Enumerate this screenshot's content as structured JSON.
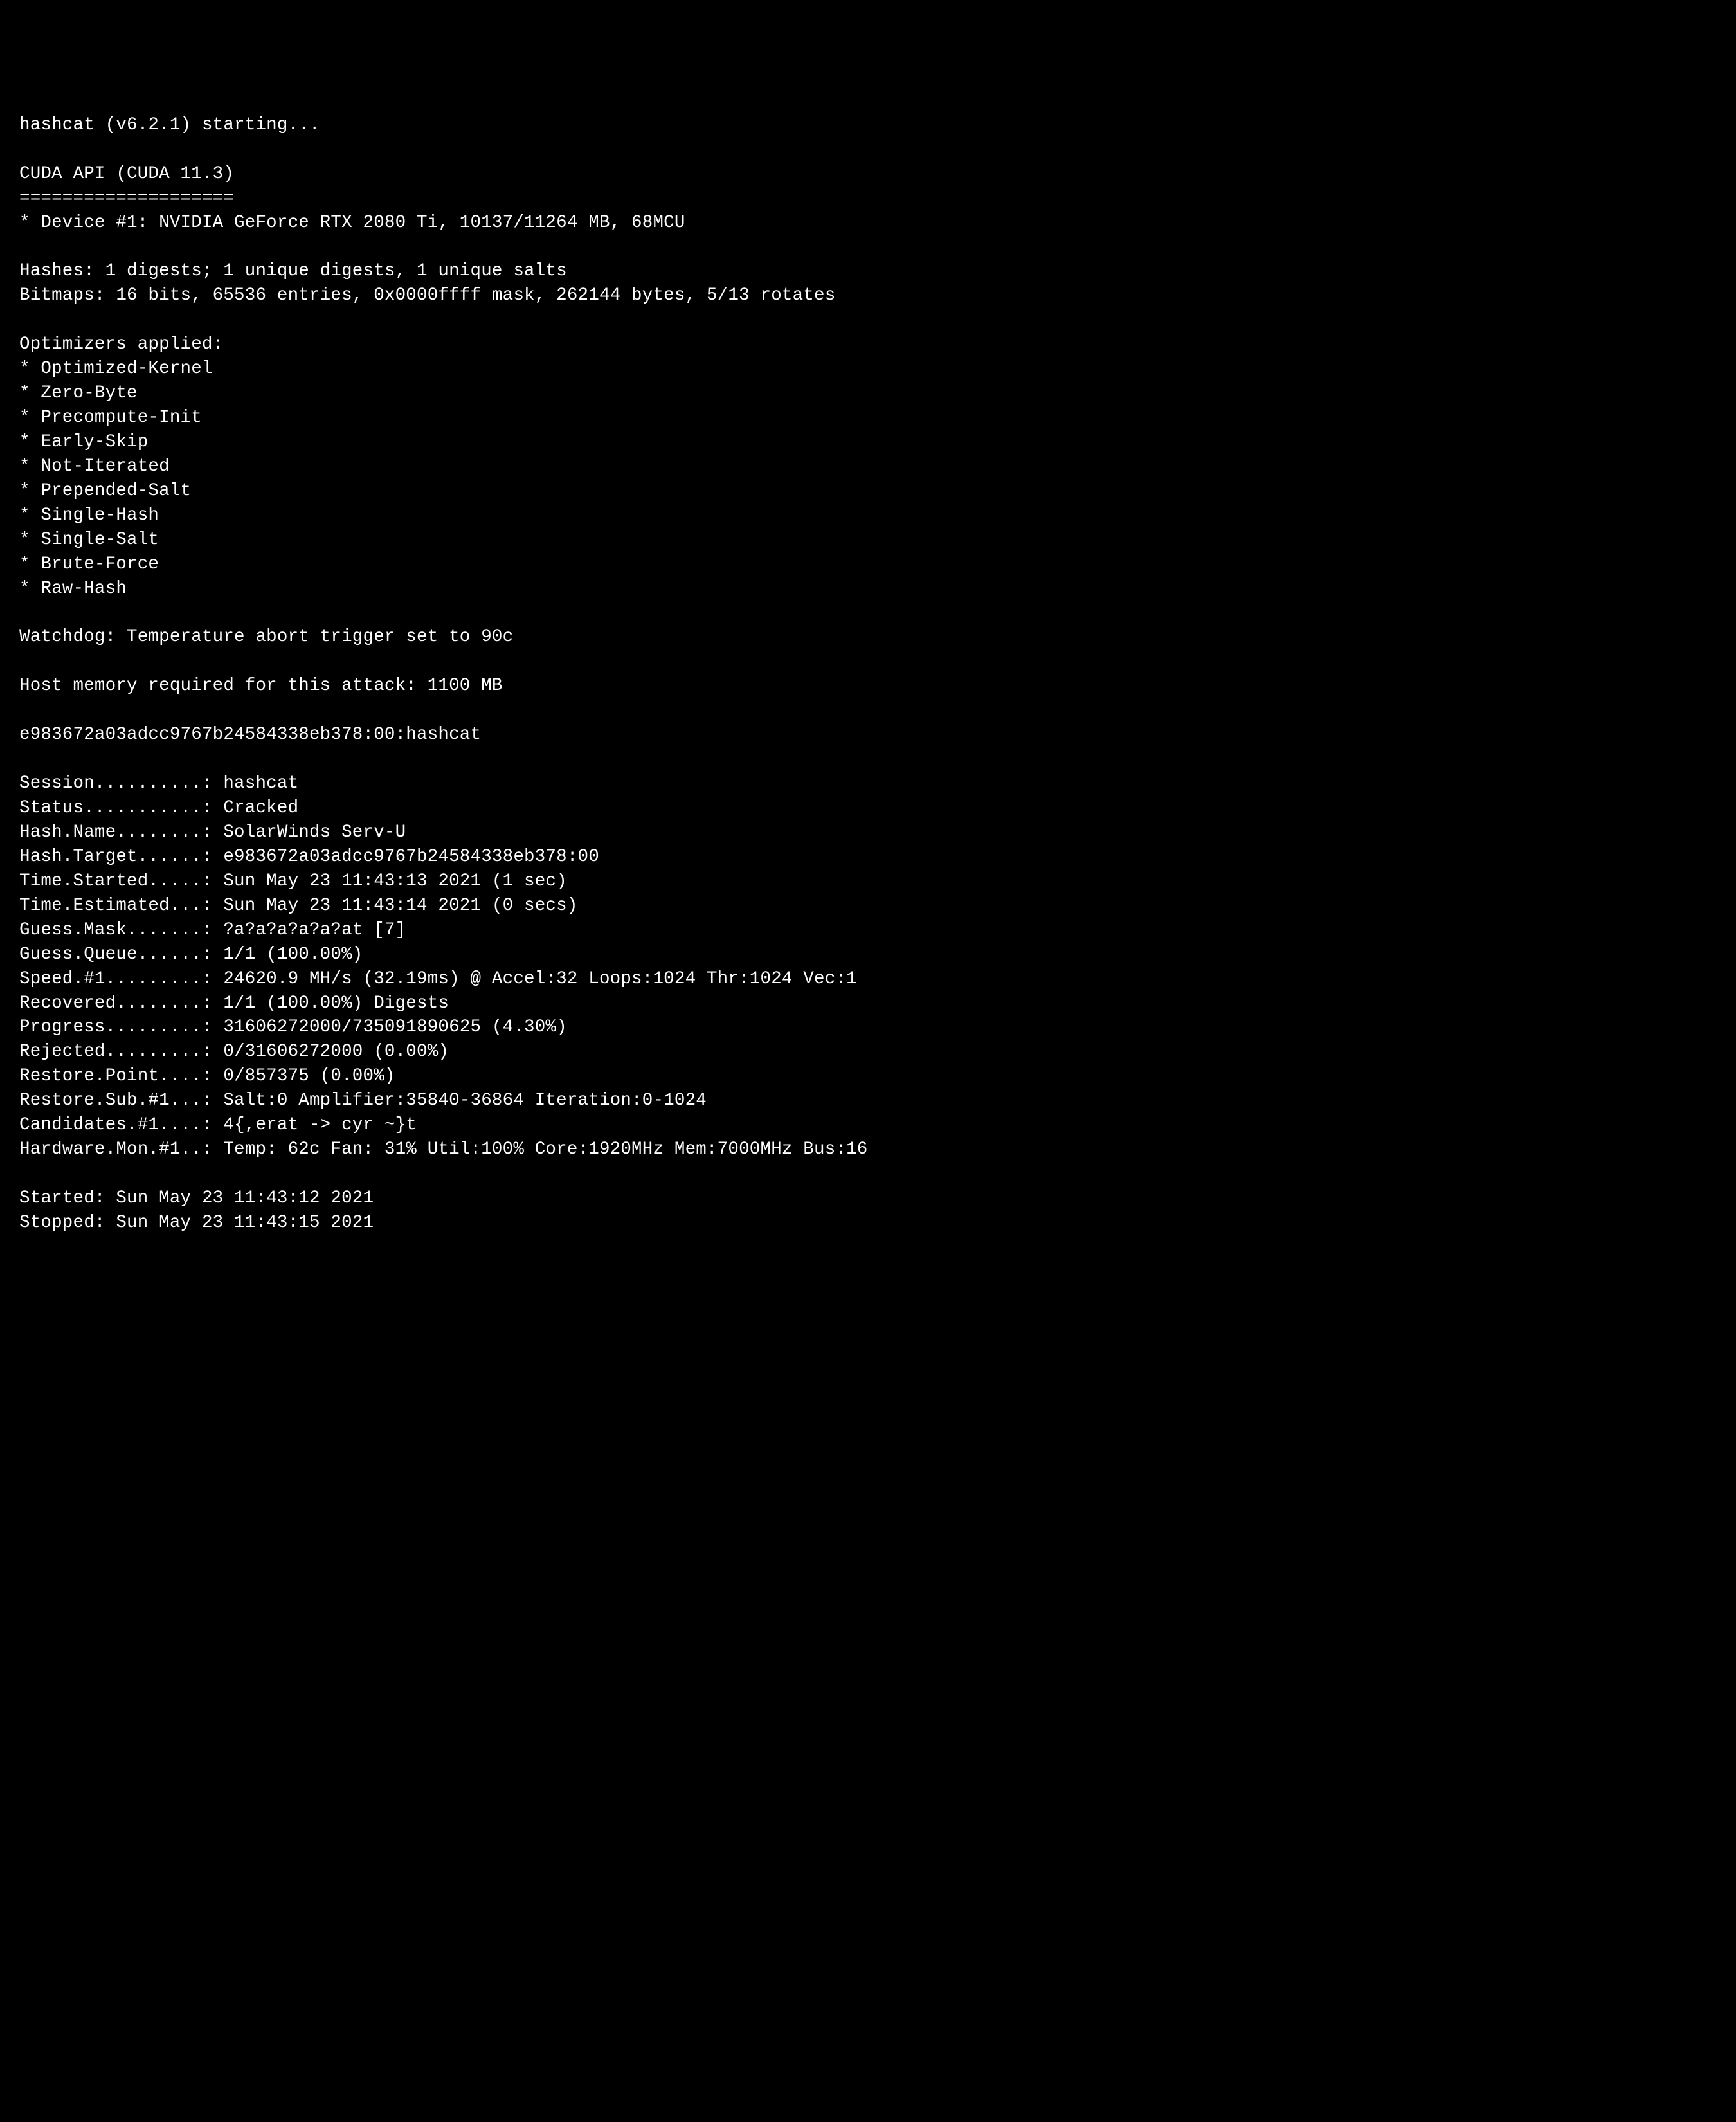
{
  "header": {
    "starting": "hashcat (v6.2.1) starting..."
  },
  "cuda": {
    "title": "CUDA API (CUDA 11.3)",
    "divider": "====================",
    "device": "* Device #1: NVIDIA GeForce RTX 2080 Ti, 10137/11264 MB, 68MCU"
  },
  "hashes": "Hashes: 1 digests; 1 unique digests, 1 unique salts",
  "bitmaps": "Bitmaps: 16 bits, 65536 entries, 0x0000ffff mask, 262144 bytes, 5/13 rotates",
  "optimizers": {
    "title": "Optimizers applied:",
    "items": [
      "* Optimized-Kernel",
      "* Zero-Byte",
      "* Precompute-Init",
      "* Early-Skip",
      "* Not-Iterated",
      "* Prepended-Salt",
      "* Single-Hash",
      "* Single-Salt",
      "* Brute-Force",
      "* Raw-Hash"
    ]
  },
  "watchdog": "Watchdog: Temperature abort trigger set to 90c",
  "hostmem": "Host memory required for this attack: 1100 MB",
  "cracked_line": "e983672a03adcc9767b24584338eb378:00:hashcat",
  "status_block": {
    "session": "Session..........: hashcat",
    "status": "Status...........: Cracked",
    "hash_name": "Hash.Name........: SolarWinds Serv-U",
    "hash_target": "Hash.Target......: e983672a03adcc9767b24584338eb378:00",
    "time_started": "Time.Started.....: Sun May 23 11:43:13 2021 (1 sec)",
    "time_estimated": "Time.Estimated...: Sun May 23 11:43:14 2021 (0 secs)",
    "guess_mask": "Guess.Mask.......: ?a?a?a?a?a?at [7]",
    "guess_queue": "Guess.Queue......: 1/1 (100.00%)",
    "speed": "Speed.#1.........: 24620.9 MH/s (32.19ms) @ Accel:32 Loops:1024 Thr:1024 Vec:1",
    "recovered": "Recovered........: 1/1 (100.00%) Digests",
    "progress": "Progress.........: 31606272000/735091890625 (4.30%)",
    "rejected": "Rejected.........: 0/31606272000 (0.00%)",
    "restore_point": "Restore.Point....: 0/857375 (0.00%)",
    "restore_sub": "Restore.Sub.#1...: Salt:0 Amplifier:35840-36864 Iteration:0-1024",
    "candidates": "Candidates.#1....: 4{,erat -> cyr ~}t",
    "hardware_mon": "Hardware.Mon.#1..: Temp: 62c Fan: 31% Util:100% Core:1920MHz Mem:7000MHz Bus:16"
  },
  "footer": {
    "started": "Started: Sun May 23 11:43:12 2021",
    "stopped": "Stopped: Sun May 23 11:43:15 2021"
  }
}
